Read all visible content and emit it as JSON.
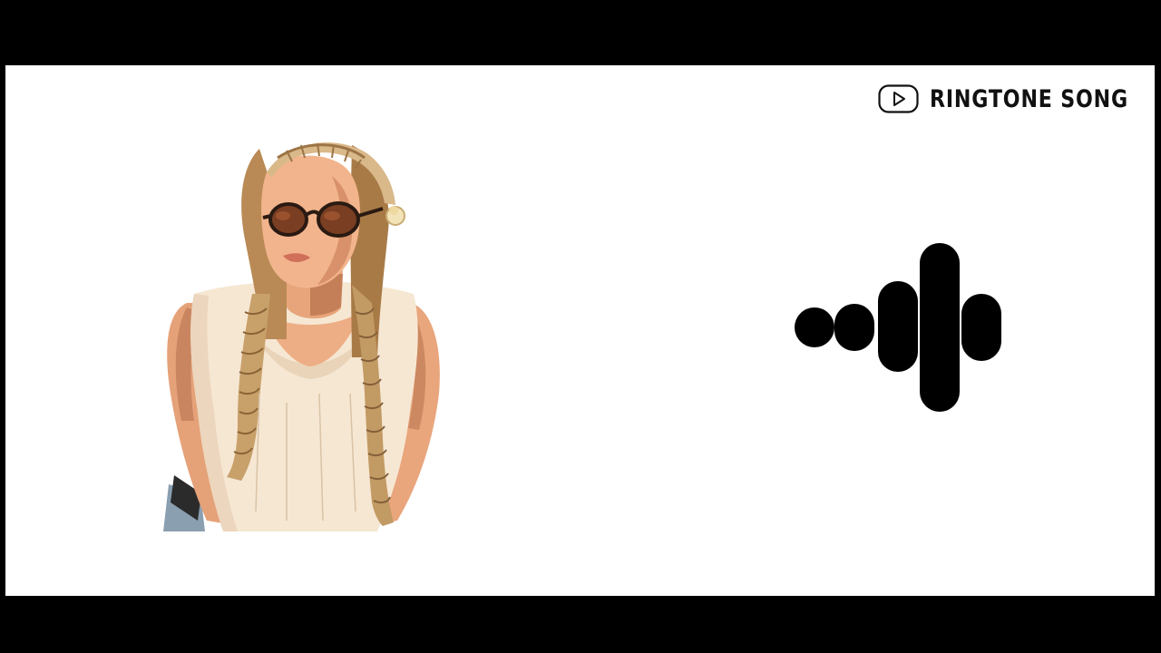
{
  "channel": {
    "name": "RINGTONE SONG",
    "icon": "play-button-outline-icon"
  },
  "illustration": {
    "subject": "illustration",
    "icon": "woman-illustration"
  },
  "waveform": {
    "icon": "audio-waveform-icon",
    "bars": 5,
    "color": "#000000"
  },
  "colors": {
    "letterbox": "#000000",
    "background": "#ffffff",
    "brand_text": "#111111"
  }
}
